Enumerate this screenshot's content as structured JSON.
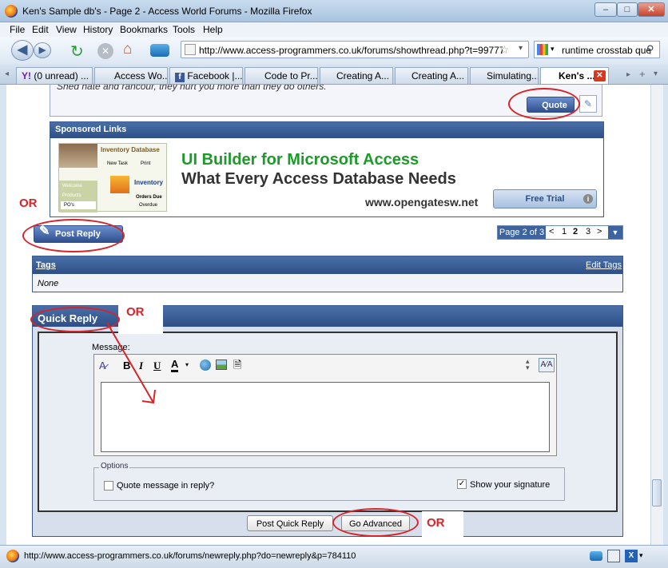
{
  "window": {
    "title": "Ken's Sample db's - Page 2 - Access World Forums - Mozilla Firefox",
    "min": "–",
    "max": "□",
    "close": "✕"
  },
  "menu": [
    "File",
    "Edit",
    "View",
    "History",
    "Bookmarks",
    "Tools",
    "Help"
  ],
  "nav": {
    "url": "http://www.access-programmers.co.uk/forums/showthread.php?t=99777&p",
    "search": "runtime crosstab que"
  },
  "tabs": [
    "(0 unread) ...",
    "Access Wo...",
    "Facebook |...",
    "Code to Pr...",
    "Creating A...",
    "Creating A...",
    "Simulating...",
    "Ken's ..."
  ],
  "post": {
    "signature": "Shed hate and rancour, they hurt you more than they do others.",
    "quote_label": "Quote"
  },
  "sponsored": {
    "header": "Sponsored Links",
    "ad_title": "UI Builder for Microsoft Access",
    "ad_subtitle": "What Every Access Database Needs",
    "ad_url": "www.opengatesw.net",
    "ad_button": "Free Trial",
    "thumb_title": "Inventory Database",
    "thumb_new": "New Task",
    "thumb_print": "Print",
    "thumb_inventory": "Inventory",
    "thumb_welcome": "Welcome",
    "thumb_products": "Products",
    "thumb_pos": "PO's",
    "thumb_orders": "Orders Due",
    "thumb_overdue": "Overdue"
  },
  "annotations": {
    "or": "OR"
  },
  "post_reply": "Post Reply",
  "pager": {
    "label": "Page 2 of 3",
    "prev": "<",
    "p1": "1",
    "p2": "2",
    "p3": "3",
    "next": ">",
    "menu": "▼"
  },
  "tags": {
    "header": "Tags",
    "edit": "Edit Tags",
    "value": "None"
  },
  "quick_reply": {
    "header": "Quick Reply",
    "message_label": "Message:",
    "options_legend": "Options",
    "quote_option": "Quote message in reply?",
    "signature_option": "Show your signature",
    "post_button": "Post Quick Reply",
    "advanced_button": "Go Advanced",
    "quote_checked": false,
    "signature_checked": true
  },
  "editor": {
    "bold": "B",
    "italic": "I",
    "underline": "U",
    "fontcolor": "A"
  },
  "status": {
    "url": "http://www.access-programmers.co.uk/forums/newreply.php?do=newreply&p=784110"
  },
  "colors": {
    "panel_blue": "#2e4f86",
    "annotation_red": "#d6242a",
    "ad_green": "#1d9a2a"
  }
}
